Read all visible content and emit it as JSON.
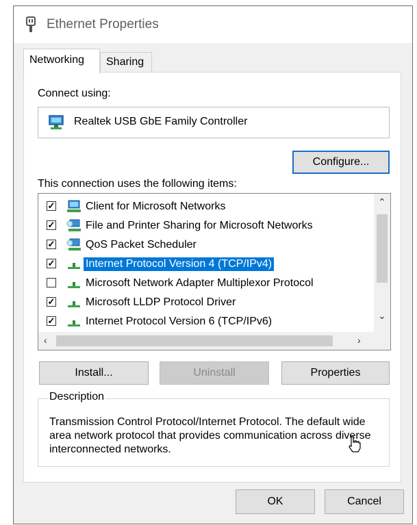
{
  "window": {
    "title": "Ethernet Properties"
  },
  "tabs": [
    {
      "label": "Networking",
      "active": true
    },
    {
      "label": "Sharing",
      "active": false
    }
  ],
  "connect": {
    "label": "Connect using:",
    "adapter": "Realtek USB GbE Family Controller",
    "adapter_icon": "network-adapter-icon",
    "configure_label": "Configure..."
  },
  "items_section": {
    "label": "This connection uses the following items:",
    "items": [
      {
        "label": "Client for Microsoft Networks",
        "checked": true,
        "icon": "network-client-icon",
        "selected": false
      },
      {
        "label": "File and Printer Sharing for Microsoft Networks",
        "checked": true,
        "icon": "network-service-icon",
        "selected": false
      },
      {
        "label": "QoS Packet Scheduler",
        "checked": true,
        "icon": "network-service-icon",
        "selected": false
      },
      {
        "label": "Internet Protocol Version 4 (TCP/IPv4)",
        "checked": true,
        "icon": "protocol-icon",
        "selected": true
      },
      {
        "label": "Microsoft Network Adapter Multiplexor Protocol",
        "checked": false,
        "icon": "protocol-icon",
        "selected": false
      },
      {
        "label": "Microsoft LLDP Protocol Driver",
        "checked": true,
        "icon": "protocol-icon",
        "selected": false
      },
      {
        "label": "Internet Protocol Version 6 (TCP/IPv6)",
        "checked": true,
        "icon": "protocol-icon",
        "selected": false
      }
    ]
  },
  "buttons": {
    "install": "Install...",
    "uninstall": "Uninstall",
    "properties": "Properties",
    "ok": "OK",
    "cancel": "Cancel"
  },
  "description": {
    "legend": "Description",
    "text": "Transmission Control Protocol/Internet Protocol. The default wide area network protocol that provides communication across diverse interconnected networks."
  },
  "colors": {
    "selection": "#0078d7",
    "default_button_border": "#1a6fc4",
    "dialog_bg": "#f0f0f0"
  }
}
